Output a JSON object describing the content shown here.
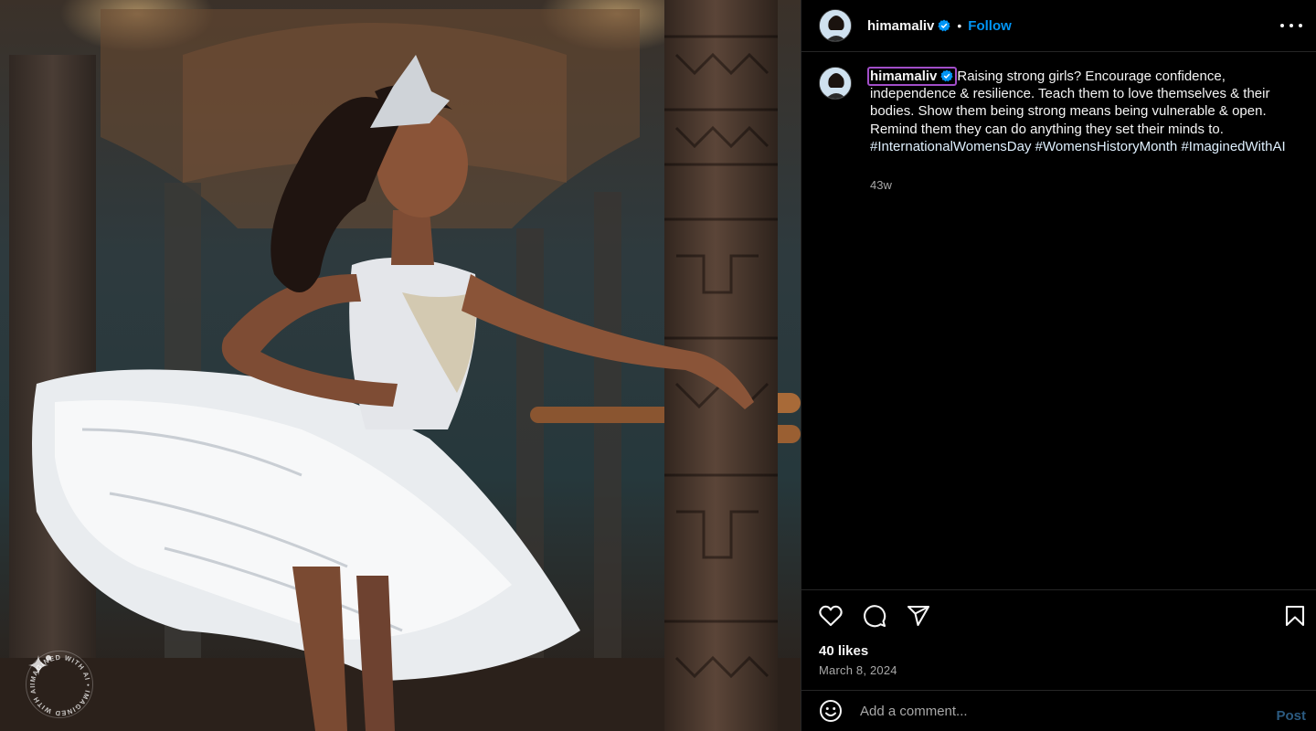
{
  "post": {
    "author": "himamaliv",
    "verified": true,
    "follow_label": "Follow",
    "separator": "•",
    "caption_text": "Raising strong girls? Encourage confidence, independence & resilience. Teach them to love themselves & their bodies. Show them being strong means being vulnerable & open. Remind them they can do anything they set their minds to. ",
    "hashtags": [
      "#InternationalWomensDay",
      "#WomensHistoryMonth",
      "#ImaginedWithAI"
    ],
    "age": "43w",
    "likes": "40 likes",
    "date": "March 8, 2024"
  },
  "comment": {
    "placeholder": "Add a comment...",
    "post_label": "Post"
  },
  "watermark": {
    "text": "IMAGINED WITH AI • IMAGINED WITH AI •"
  },
  "icons": {
    "header": [
      "avatar",
      "verified-badge-icon",
      "more-options-icon"
    ],
    "actions": [
      "heart-icon",
      "comment-icon",
      "share-icon",
      "bookmark-icon"
    ],
    "comment": [
      "emoji-icon"
    ]
  },
  "colors": {
    "link_blue": "#0095f6",
    "post_disabled": "#2b5a80",
    "hashtag": "#e0f1ff",
    "muted": "#a8a8a8",
    "handle_highlight": "#a24ec9"
  }
}
